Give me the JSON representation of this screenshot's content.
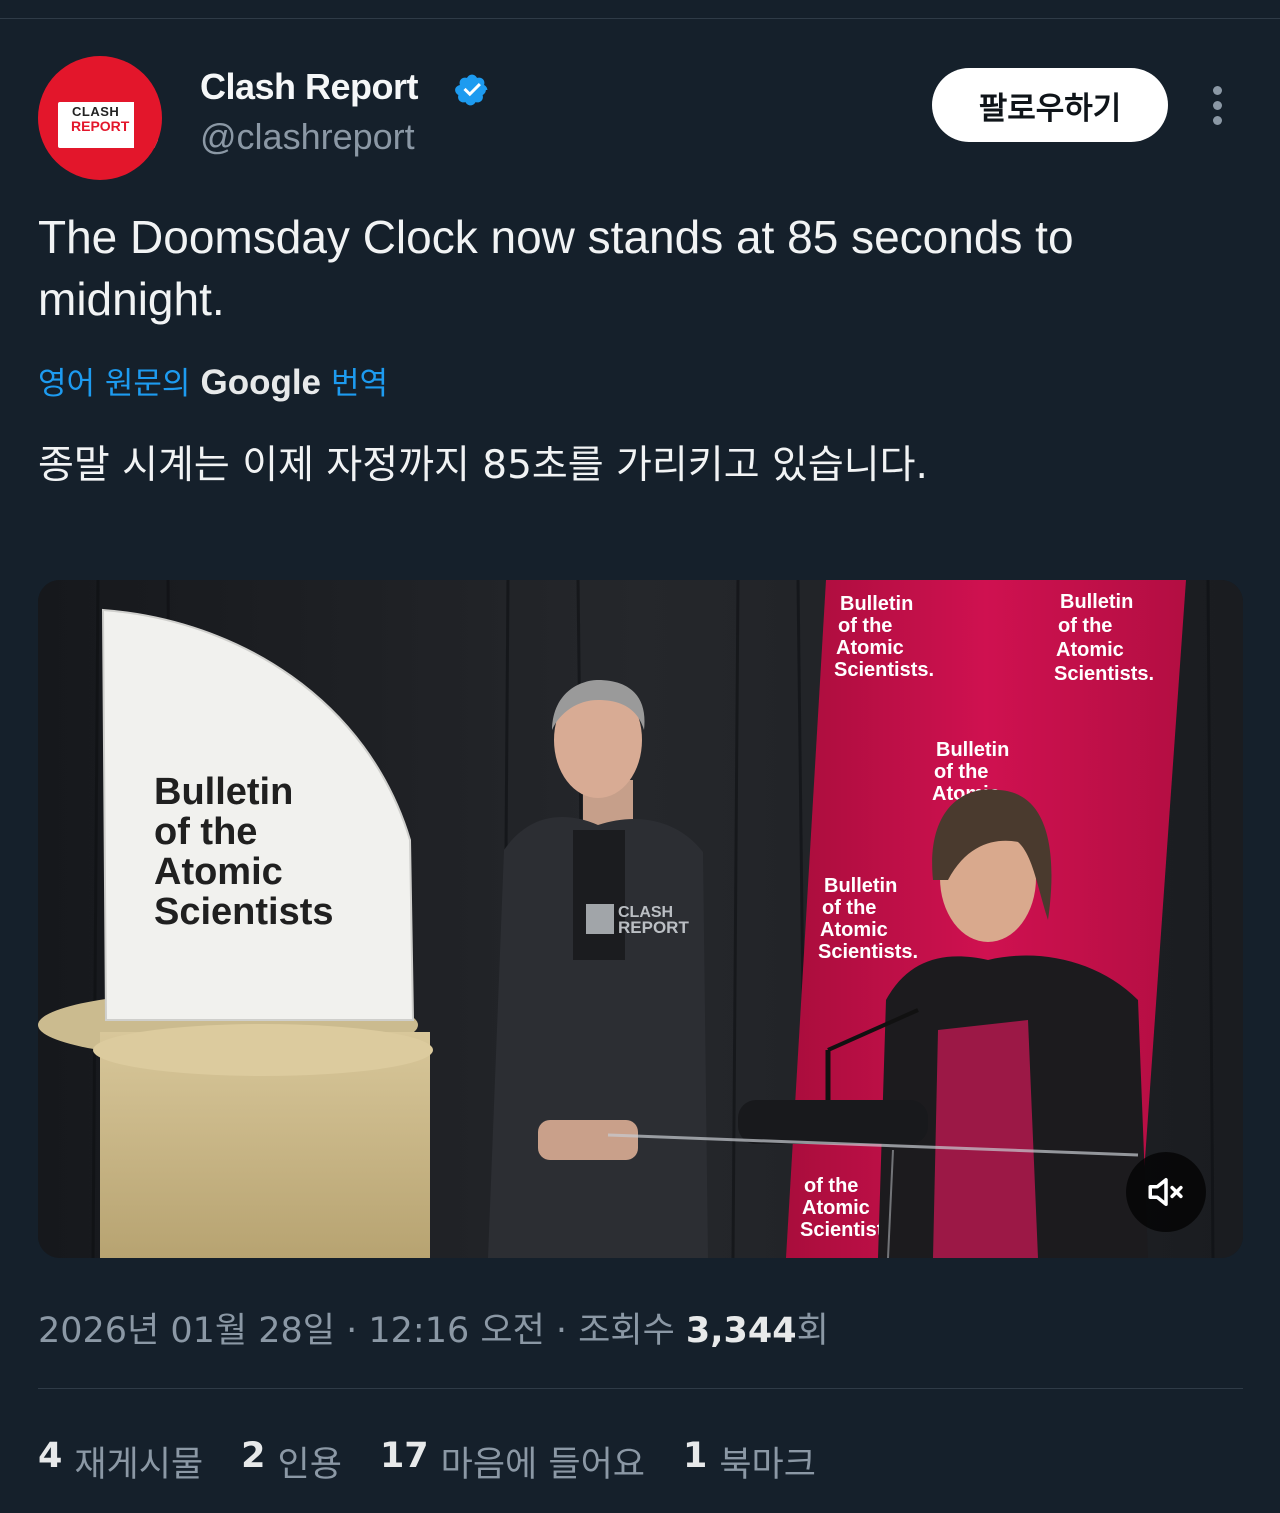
{
  "author": {
    "display_name": "Clash Report",
    "handle": "@clashreport",
    "avatar_text_top": "CLASH",
    "avatar_text_bottom": "REPORT",
    "verified": true
  },
  "follow_label": "팔로우하기",
  "tweet": {
    "text": "The Doomsday Clock now stands at 85 seconds to midnight.",
    "translation_prefix": "영어 원문의",
    "translation_brand": "Google",
    "translation_suffix": "번역",
    "translated_text": "종말 시계는 이제 자정까지 85초를 가리키고 있습니다."
  },
  "media": {
    "podium_sign": [
      "Bulletin",
      "of the",
      "Atomic",
      "Scientists"
    ],
    "banner_text": [
      "Bulletin",
      "of the",
      "Atomic",
      "Scientists."
    ],
    "watermark_top": "CLASH",
    "watermark_bottom": "REPORT"
  },
  "meta": {
    "date": "2026년 01월 28일",
    "sep1": " · ",
    "time": "12:16 오전",
    "sep2": " · ",
    "views_label": "조회수 ",
    "views_count": "3,344",
    "views_suffix": "회"
  },
  "stats": {
    "reposts_count": "4",
    "reposts_label": "재게시물",
    "quotes_count": "2",
    "quotes_label": "인용",
    "likes_count": "17",
    "likes_label": "마음에 들어요",
    "bookmarks_count": "1",
    "bookmarks_label": "북마크"
  },
  "colors": {
    "background": "#15202b",
    "link": "#1d9bf0",
    "brand_red": "#e3162b",
    "banner_red": "#c8104a"
  }
}
